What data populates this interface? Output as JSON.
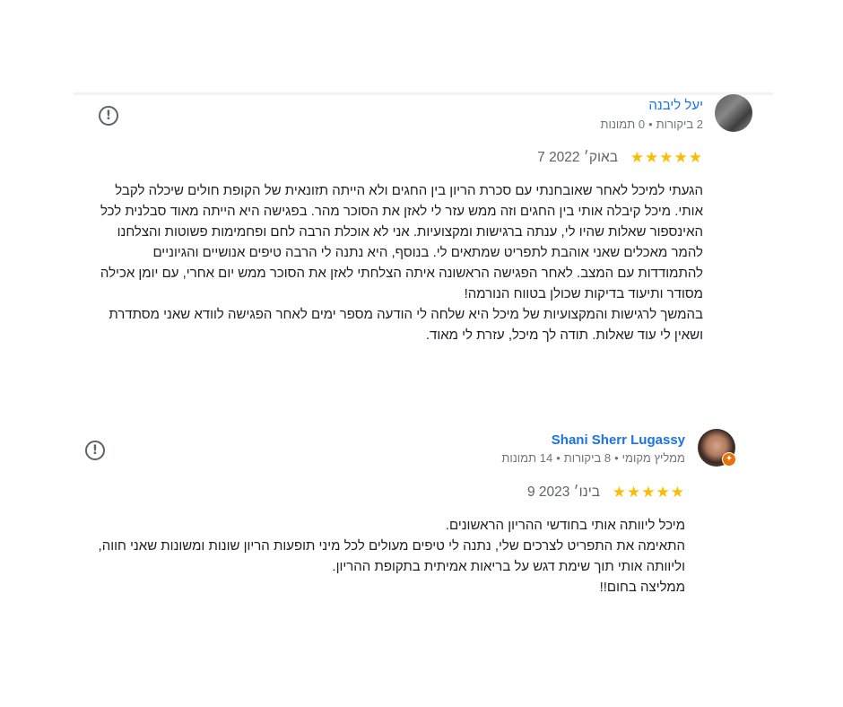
{
  "reviews": [
    {
      "author": "יעל ליבנה",
      "meta": [
        "2 ביקורות",
        "•",
        "0 תמונות"
      ],
      "stars": "★★★★★",
      "date": "7 באוק׳ 2022",
      "text": "הגעתי למיכל לאחר שאובחנתי עם סכרת הריון בין החגים ולא הייתה תזונאית של הקופת חולים שיכלה לקבל אותי. מיכל קיבלה אותי בין החגים וזה ממש עזר לי לאזן את הסוכר מהר. בפגישה היא הייתה מאוד סבלנית לכל האינספור שאלות שהיו לי, ענתה ברגישות ומקצועיות. אני לא אוכלת הרבה לחם ופחמימות פשוטות והצלחנו להמר מאכלים שאני אוהבת לתפריט שמתאים לי. בנוסף, היא נתנה לי הרבה טיפים אנושיים והגיוניים להתמודדות עם המצב. לאחר הפגישה הראשונה איתה הצלחתי לאזן את הסוכר ממש יום אחרי, עם יומן אכילה מסודר ותיעוד בדיקות שכולן בטווח הנורמה!\nבהמשך לרגישות והמקצועיות של מיכל היא שלחה לי הודעה מספר ימים לאחר הפגישה לוודא שאני מסתדרת ושאין לי עוד שאלות. תודה לך מיכל, עזרת לי מאוד.",
      "report_icon": "flag-icon"
    },
    {
      "author": "Shani Sherr Lugassy",
      "meta": [
        "ממליץ מקומי",
        "•",
        "8 ביקורות",
        "•",
        "14 תמונות"
      ],
      "stars": "★★★★★",
      "date": "9 בינו׳ 2023",
      "text": "מיכל ליוותה אותי בחודשי ההריון הראשונים.\nהתאימה את התפריט לצרכים שלי, נתנה לי טיפים מעולים לכל מיני תופעות הריון שונות ומשונות שאני חווה, וליוותה אותי תוך שימת דגש על בריאות אמיתית בתקופת ההריון.\nממליצה בחום!!",
      "report_icon": "flag-icon"
    }
  ],
  "colors": {
    "star": "#fbbc04",
    "author": "#1a73e8",
    "local_guide_badge": "#e8710a"
  }
}
